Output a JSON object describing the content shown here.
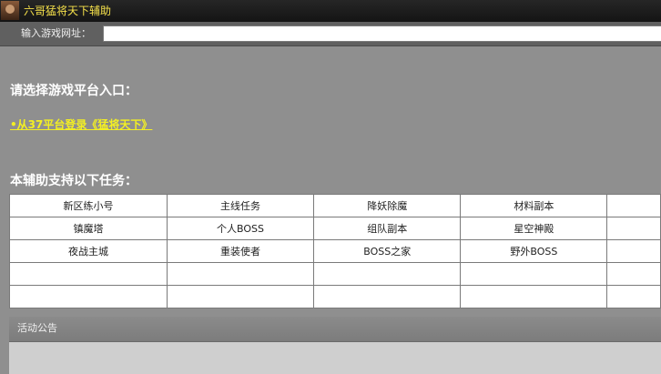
{
  "window": {
    "title": "六哥猛将天下辅助",
    "icon": "avatar-portrait-icon"
  },
  "url_bar": {
    "label": "输入游戏网址：",
    "value": "",
    "placeholder": ""
  },
  "platform_section": {
    "heading": "请选择游戏平台入口：",
    "link": "•从37平台登录《猛将天下》"
  },
  "tasks_section": {
    "heading": "本辅助支持以下任务：",
    "rows": [
      [
        "新区练小号",
        "主线任务",
        "降妖除魔",
        "材料副本",
        ""
      ],
      [
        "镇魔塔",
        "个人BOSS",
        "组队副本",
        "星空神殿",
        ""
      ],
      [
        "夜战主城",
        "重装使者",
        "BOSS之家",
        "野外BOSS",
        ""
      ],
      [
        "",
        "",
        "",
        "",
        ""
      ],
      [
        "",
        "",
        "",
        "",
        ""
      ]
    ]
  },
  "notice": {
    "title": "活动公告"
  },
  "colors": {
    "title_text": "#f5e04a",
    "link": "#f3ef23",
    "background": "#8f8f8f"
  }
}
